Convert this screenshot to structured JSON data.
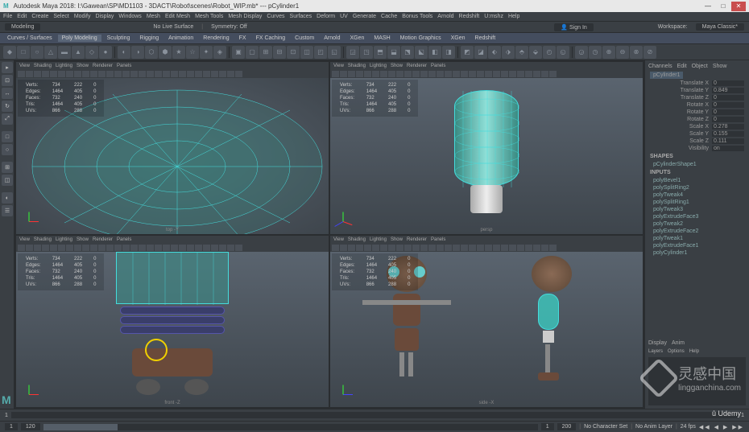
{
  "titlebar": {
    "app_icon": "M",
    "title": "Autodesk Maya 2018: I:\\Gawean\\SP\\MD1103 - 3DACT\\Robot\\scenes\\Robot_WIP.mb* --- pCylinder1",
    "min": "—",
    "max": "□",
    "close": "✕"
  },
  "menubar": [
    "File",
    "Edit",
    "Create",
    "Select",
    "Modify",
    "Display",
    "Windows",
    "Mesh",
    "Edit Mesh",
    "Mesh Tools",
    "Mesh Display",
    "Curves",
    "Surfaces",
    "Deform",
    "UV",
    "Generate",
    "Cache",
    "Bonus Tools",
    "Arnold",
    "Redshift",
    "U:mshz",
    "Help"
  ],
  "statusline": {
    "workspace_dd": "Modeling",
    "no_live": "No Live Surface",
    "symmetry": "Symmetry: Off",
    "signin": "Sign In",
    "workspace_lbl": "Workspace:",
    "workspace_val": "Maya Classic*"
  },
  "shelf_tabs": [
    "Curves / Surfaces",
    "Poly Modeling",
    "Sculpting",
    "Rigging",
    "Animation",
    "Rendering",
    "FX",
    "FX Caching",
    "Custom",
    "Arnold",
    "XGen",
    "MASH",
    "Motion Graphics",
    "XGen",
    "Redshift"
  ],
  "shelf_active": 1,
  "vp_menu": [
    "View",
    "Shading",
    "Lighting",
    "Show",
    "Renderer",
    "Panels"
  ],
  "hud_rows": [
    {
      "label": "Verts:",
      "a": "734",
      "b": "222",
      "c": "0"
    },
    {
      "label": "Edges:",
      "a": "1464",
      "b": "405",
      "c": "0"
    },
    {
      "label": "Faces:",
      "a": "732",
      "b": "240",
      "c": "0"
    },
    {
      "label": "Tris:",
      "a": "1464",
      "b": "405",
      "c": "0"
    },
    {
      "label": "UVs:",
      "a": "866",
      "b": "288",
      "c": "0"
    }
  ],
  "vp_labels": {
    "tl": "top -Y",
    "tr": "persp",
    "bl": "front -Z",
    "br": "side -X"
  },
  "channels": {
    "tabs": [
      "Channels",
      "Edit",
      "Object",
      "Show"
    ],
    "object": "pCylinder1",
    "attrs": [
      {
        "lab": "Translate X",
        "val": "0"
      },
      {
        "lab": "Translate Y",
        "val": "0.849"
      },
      {
        "lab": "Translate Z",
        "val": "0"
      },
      {
        "lab": "Rotate X",
        "val": "0"
      },
      {
        "lab": "Rotate Y",
        "val": "0"
      },
      {
        "lab": "Rotate Z",
        "val": "0"
      },
      {
        "lab": "Scale X",
        "val": "0.278"
      },
      {
        "lab": "Scale Y",
        "val": "0.155"
      },
      {
        "lab": "Scale Z",
        "val": "0.111"
      },
      {
        "lab": "Visibility",
        "val": "on"
      }
    ],
    "shapes_h": "SHAPES",
    "shape": "pCylinderShape1",
    "inputs_h": "INPUTS",
    "inputs": [
      "polyBevel1",
      "polySplitRing2",
      "polyTweak4",
      "polySplitRing1",
      "polyTweak3",
      "polyExtrudeFace3",
      "polyTweak2",
      "polyExtrudeFace2",
      "polyTweak1",
      "polyExtrudeFace1",
      "polyCylinder1"
    ]
  },
  "layers": {
    "tabs": [
      "Display",
      "Anim"
    ],
    "sub": [
      "Layers",
      "Options",
      "Help"
    ]
  },
  "timeslider": {
    "start": "1",
    "cur": "1"
  },
  "rangeslider": {
    "start": "1",
    "end": "120",
    "rstart": "1",
    "rend": "200",
    "charset": "No Character Set",
    "animlayer": "No Anim Layer",
    "fps": "24 fps"
  },
  "watermark": {
    "cn": "灵感中国",
    "url": "lingganchina.com"
  },
  "udemy": "Udemy",
  "mlogo": "M"
}
